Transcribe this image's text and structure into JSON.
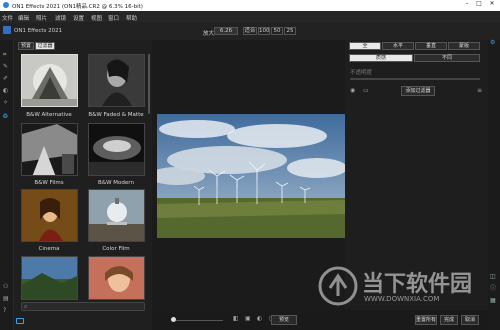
{
  "titlebar": {
    "title": "ON1 Effects 2021 (ON1精品.CR2 @ 6.3% 16-bit)"
  },
  "menubar": {
    "items": [
      "文件",
      "编辑",
      "照片",
      "滤镜",
      "设置",
      "视图",
      "窗口",
      "帮助"
    ]
  },
  "toolbar": {
    "doc_name": "ON1 Effects 2021",
    "zoom_label": "放大",
    "zoom_value": "6.26",
    "fit_label": "适合",
    "zoom_presets": [
      "100",
      "50",
      "25"
    ]
  },
  "browser": {
    "tabs": [
      "预置",
      "过滤器"
    ],
    "thumbnails": [
      {
        "label": "B&W Alternative"
      },
      {
        "label": "B&W Faded & Matte"
      },
      {
        "label": "B&W Films"
      },
      {
        "label": "B&W Modern"
      },
      {
        "label": "Cinema"
      },
      {
        "label": "Color Film"
      },
      {
        "label": ""
      },
      {
        "label": ""
      }
    ],
    "search_placeholder": ""
  },
  "rightpanel": {
    "tabs": [
      "全",
      "水平",
      "垂直",
      "蒙版"
    ],
    "subtabs": [
      "质感",
      "不同"
    ],
    "sample_label": "不透明度",
    "add_filter": "添加过滤器"
  },
  "bottombar": {
    "preview": "预览",
    "reset": "重置所有",
    "done": "完成",
    "cancel": "取消"
  },
  "watermark": {
    "cn": "当下软件园",
    "en": "WWW.DOWNXIA.COM"
  }
}
